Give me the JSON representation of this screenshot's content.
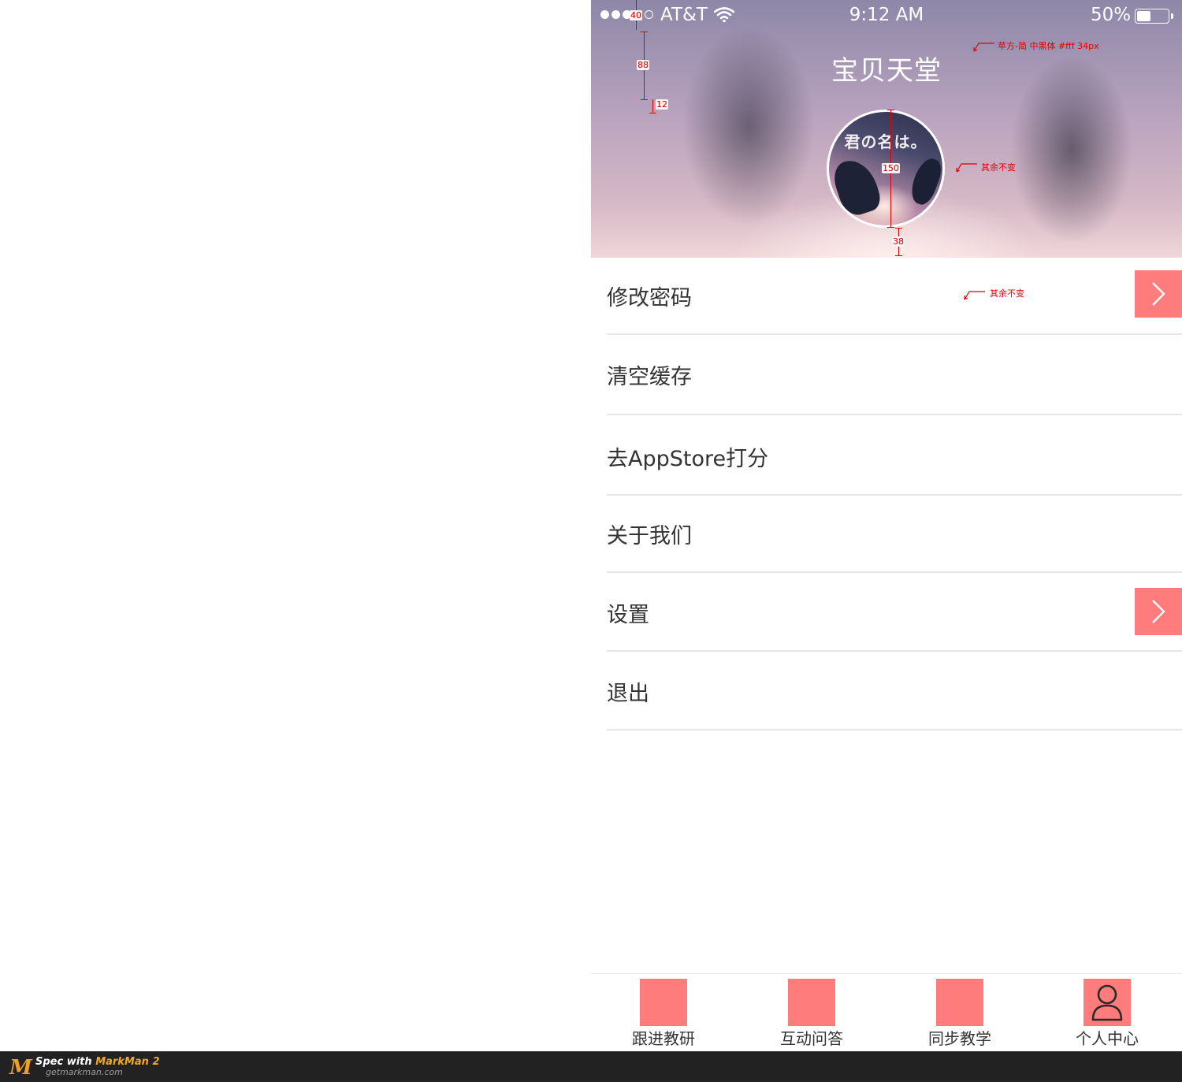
{
  "statusbar": {
    "carrier": "AT&T",
    "time": "9:12 AM",
    "battery_percent": "50%",
    "battery_level": 0.5,
    "signal_bars_filled": 4,
    "signal_bars_total": 5
  },
  "header": {
    "title": "宝贝天堂",
    "avatar_text": "君の名は。"
  },
  "annotations": {
    "font_note": "苹方-简 中黑体 #fff 34px",
    "avatar_note": "其余不变",
    "row_note": "其余不变",
    "measure_status": "40",
    "measure_nav": "88",
    "measure_gap": "12",
    "measure_avatar": "150",
    "measure_bottom": "38"
  },
  "menu": {
    "items": [
      {
        "label": "修改密码",
        "has_arrow": true
      },
      {
        "label": "清空缓存",
        "has_arrow": false
      },
      {
        "label": "去AppStore打分",
        "has_arrow": false
      },
      {
        "label": "关于我们",
        "has_arrow": false
      },
      {
        "label": "设置",
        "has_arrow": true
      },
      {
        "label": "退出",
        "has_arrow": false
      }
    ]
  },
  "tabbar": {
    "tabs": [
      {
        "label": "跟进教研",
        "icon": "placeholder-icon"
      },
      {
        "label": "互动问答",
        "icon": "placeholder-icon"
      },
      {
        "label": "同步教学",
        "icon": "placeholder-icon"
      },
      {
        "label": "个人中心",
        "icon": "user-icon"
      }
    ]
  },
  "footer": {
    "line1_prefix": "Spec with ",
    "line1_brand": "MarkMan 2",
    "line2": "getmarkman.com",
    "logo_letter": "M"
  },
  "colors": {
    "accent": "#ff7c7c",
    "text": "#333333",
    "separator": "#e6e6e6",
    "annotation": "#e00000"
  }
}
